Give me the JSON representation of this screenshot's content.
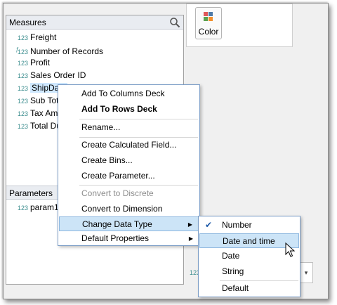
{
  "measures": {
    "header": "Measures",
    "fields": [
      {
        "label": "Freight",
        "icon": "123",
        "calculated": false,
        "selected": false
      },
      {
        "label": "Number of Records",
        "icon": "123",
        "calculated": true,
        "selected": false
      },
      {
        "label": "Profit",
        "icon": "123",
        "calculated": false,
        "selected": false
      },
      {
        "label": "Sales Order ID",
        "icon": "123",
        "calculated": false,
        "selected": false
      },
      {
        "label": "ShipDate",
        "icon": "123",
        "calculated": false,
        "selected": true
      },
      {
        "label": "Sub Total",
        "icon": "123",
        "calculated": false,
        "selected": false
      },
      {
        "label": "Tax Amou",
        "icon": "123",
        "calculated": false,
        "selected": false
      },
      {
        "label": "Total Due",
        "icon": "123",
        "calculated": false,
        "selected": false
      }
    ]
  },
  "parameters": {
    "header": "Parameters",
    "fields": [
      {
        "label": "param1",
        "icon": "123"
      }
    ]
  },
  "marks": {
    "color_label": "Color"
  },
  "context_menu": {
    "items": [
      {
        "label": "Add To Columns Deck"
      },
      {
        "label": "Add To Rows Deck"
      },
      {
        "label": "Rename..."
      },
      {
        "label": "Create Calculated Field..."
      },
      {
        "label": "Create Bins..."
      },
      {
        "label": "Create Parameter..."
      },
      {
        "label": "Convert to Discrete"
      },
      {
        "label": "Convert to Dimension"
      },
      {
        "label": "Change Data Type"
      },
      {
        "label": "Default Properties"
      }
    ]
  },
  "submenu": {
    "items": [
      {
        "label": "Number",
        "checked": true
      },
      {
        "label": "Date and time",
        "highlighted": true
      },
      {
        "label": "Date"
      },
      {
        "label": "String"
      },
      {
        "label": "Default"
      }
    ]
  },
  "misc": {
    "mini_icon": "123",
    "dropdown_glyph": "▾"
  },
  "colors": {
    "highlight": "#cce4f7",
    "field_icon": "#3b8d8e",
    "menu_border": "#7a9cc6"
  }
}
